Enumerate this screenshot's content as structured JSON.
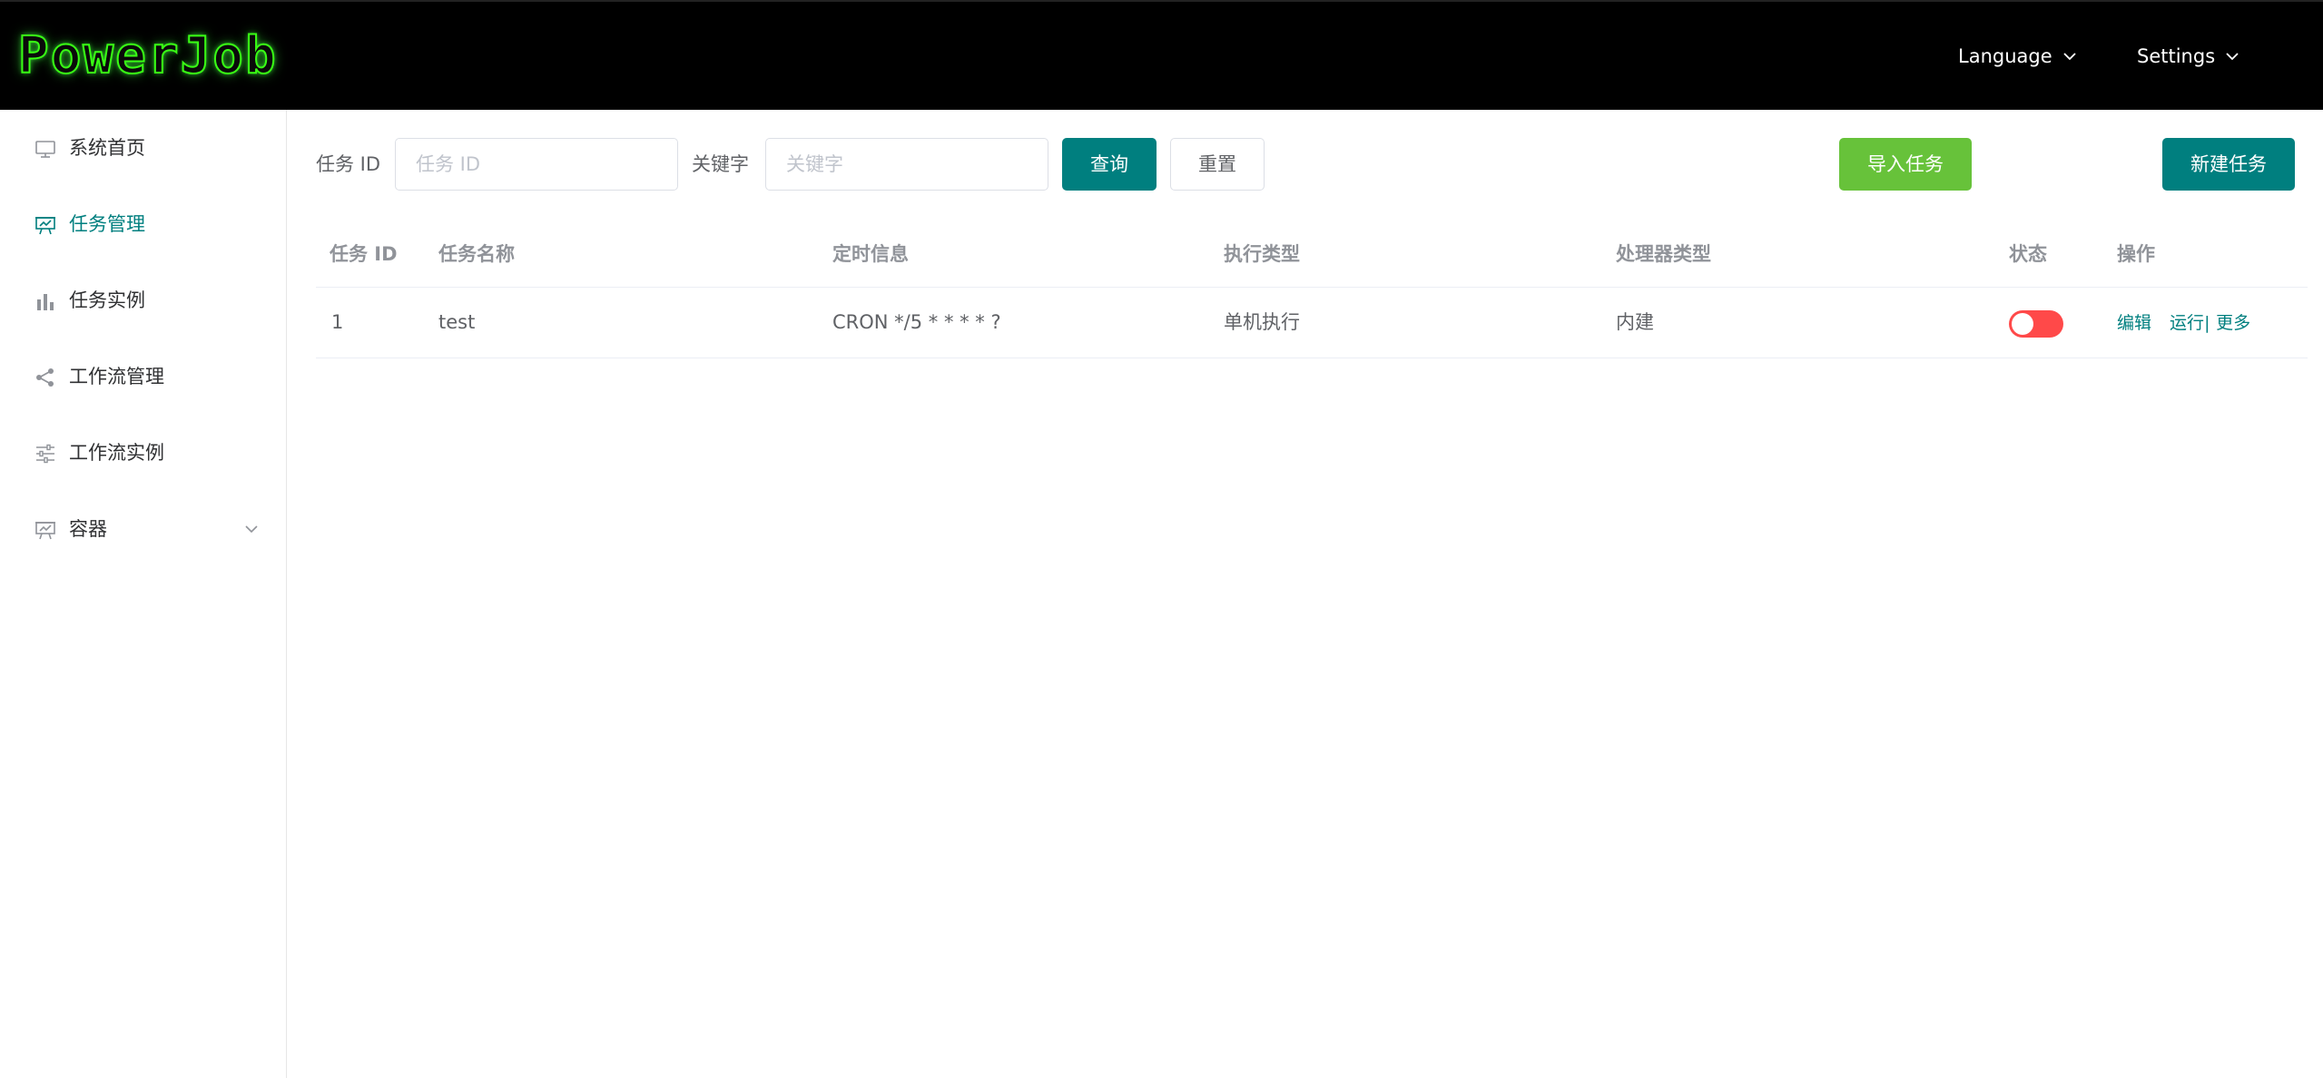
{
  "header": {
    "logo": "PowerJob",
    "language_label": "Language",
    "settings_label": "Settings"
  },
  "sidebar": {
    "items": [
      {
        "label": "系统首页",
        "icon": "monitor-icon",
        "active": false
      },
      {
        "label": "任务管理",
        "icon": "presentation-icon",
        "active": true
      },
      {
        "label": "任务实例",
        "icon": "bar-chart-icon",
        "active": false
      },
      {
        "label": "工作流管理",
        "icon": "share-icon",
        "active": false
      },
      {
        "label": "工作流实例",
        "icon": "sliders-icon",
        "active": false
      },
      {
        "label": "容器",
        "icon": "presentation-icon",
        "active": false,
        "expandable": true
      }
    ]
  },
  "filter": {
    "task_id_label": "任务 ID",
    "task_id_placeholder": "任务 ID",
    "task_id_value": "",
    "keyword_label": "关键字",
    "keyword_placeholder": "关键字",
    "keyword_value": "",
    "query_button": "查询",
    "reset_button": "重置",
    "import_button": "导入任务",
    "new_button": "新建任务"
  },
  "table": {
    "columns": [
      "任务 ID",
      "任务名称",
      "定时信息",
      "执行类型",
      "处理器类型",
      "状态",
      "操作"
    ],
    "rows": [
      {
        "id": "1",
        "name": "test",
        "schedule": "CRON */5 * * * * ?",
        "execute_type": "单机执行",
        "processor_type": "内建",
        "enabled": false,
        "actions": {
          "edit": "编辑",
          "run": "运行",
          "separator": "|",
          "more": "更多"
        }
      }
    ]
  },
  "colors": {
    "primary": "#007f7f",
    "success": "#67c23a",
    "switch_off": "#ff4949",
    "header_bg": "#000000",
    "logo_glow": "#39ff14"
  }
}
